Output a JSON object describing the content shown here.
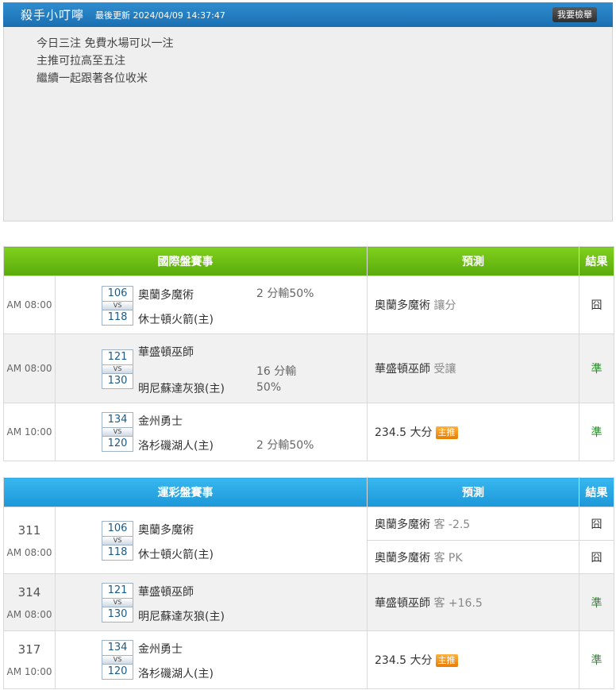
{
  "header": {
    "name": "殺手小叮嚀",
    "updated": "最後更新 2024/04/09 14:37:47",
    "report_label": "我要檢舉"
  },
  "notes": [
    "今日三注 免費水場可以一注",
    "主推可拉高至五注",
    "繼續一起跟著各位收米"
  ],
  "intl": {
    "headers": [
      "國際盤賽事",
      "預測",
      "結果"
    ],
    "rows": [
      {
        "time": "AM 08:00",
        "s1": "106",
        "s2": "118",
        "team1": "奧蘭多魔術",
        "team2": "休士頓火箭(主)",
        "odds": "2 分輸50%",
        "pred": "奧蘭多魔術",
        "pred_sub": "讓分",
        "result": "囧"
      },
      {
        "time": "AM 08:00",
        "s1": "121",
        "s2": "130",
        "team1": "華盛頓巫師",
        "team2": "明尼蘇達灰狼(主)",
        "odds": "16 分輸",
        "odds2": "50%",
        "pred": "華盛頓巫師",
        "pred_sub": "受讓",
        "result": "準"
      },
      {
        "time": "AM 10:00",
        "s1": "134",
        "s2": "120",
        "team1": "金州勇士",
        "team2": "洛杉磯湖人(主)",
        "odds": "2 分輸50%",
        "pred": "234.5 大分",
        "badge": "主推",
        "result": "準"
      }
    ]
  },
  "lot": {
    "headers": [
      "運彩盤賽事",
      "預測",
      "結果"
    ],
    "rows": [
      {
        "num": "311",
        "time": "AM 08:00",
        "s1": "106",
        "s2": "118",
        "team1": "奧蘭多魔術",
        "team2": "休士頓火箭(主)",
        "preds": [
          {
            "pred": "奧蘭多魔術",
            "pred_sub": "客 -2.5",
            "result": "囧"
          },
          {
            "pred": "奧蘭多魔術",
            "pred_sub": "客 PK",
            "result": "囧"
          }
        ]
      },
      {
        "num": "314",
        "time": "AM 08:00",
        "s1": "121",
        "s2": "130",
        "team1": "華盛頓巫師",
        "team2": "明尼蘇達灰狼(主)",
        "preds": [
          {
            "pred": "華盛頓巫師",
            "pred_sub": "客 +16.5",
            "result": "準"
          }
        ]
      },
      {
        "num": "317",
        "time": "AM 10:00",
        "s1": "134",
        "s2": "120",
        "team1": "金州勇士",
        "team2": "洛杉磯湖人(主)",
        "preds": [
          {
            "pred": "234.5 大分",
            "badge": "主推",
            "result": "準"
          }
        ]
      }
    ]
  }
}
